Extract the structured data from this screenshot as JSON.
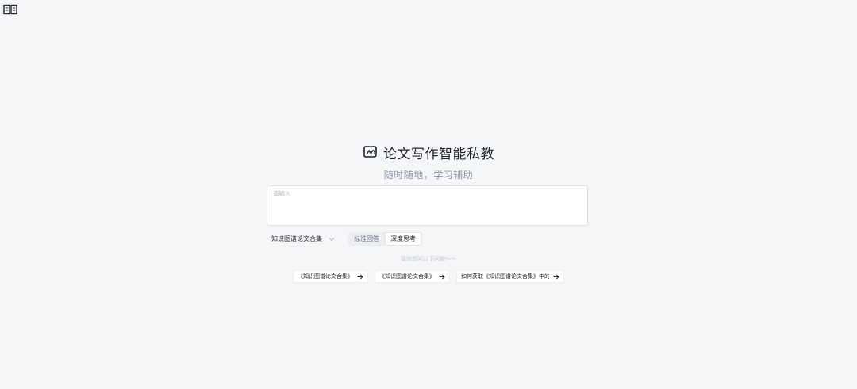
{
  "icons": {
    "corner": "open-book-icon",
    "logo": "thesis-logo-icon",
    "select_chevron": "chevron-down-icon",
    "chip_arrow": "arrow-right-icon"
  },
  "hero": {
    "title": "论文写作智能私教",
    "subtitle": "随时随地，学习辅助"
  },
  "input": {
    "value": "",
    "placeholder": "请输入"
  },
  "controls": {
    "knowledge_base": "知识图谱论文合集",
    "modes": [
      {
        "label": "标准回答",
        "active": false
      },
      {
        "label": "深度思考",
        "active": true
      }
    ]
  },
  "hint": "猜你想问以下问题～～",
  "suggestions": [
    {
      "label": "《知识图谱论文合集》"
    },
    {
      "label": "《知识图谱论文合集》"
    },
    {
      "label": "如何获取《知识图谱论文合集》中的"
    }
  ],
  "colors": {
    "background": "#f5f6f8",
    "subtitle": "#8a95a8",
    "text": "#1f2329"
  }
}
